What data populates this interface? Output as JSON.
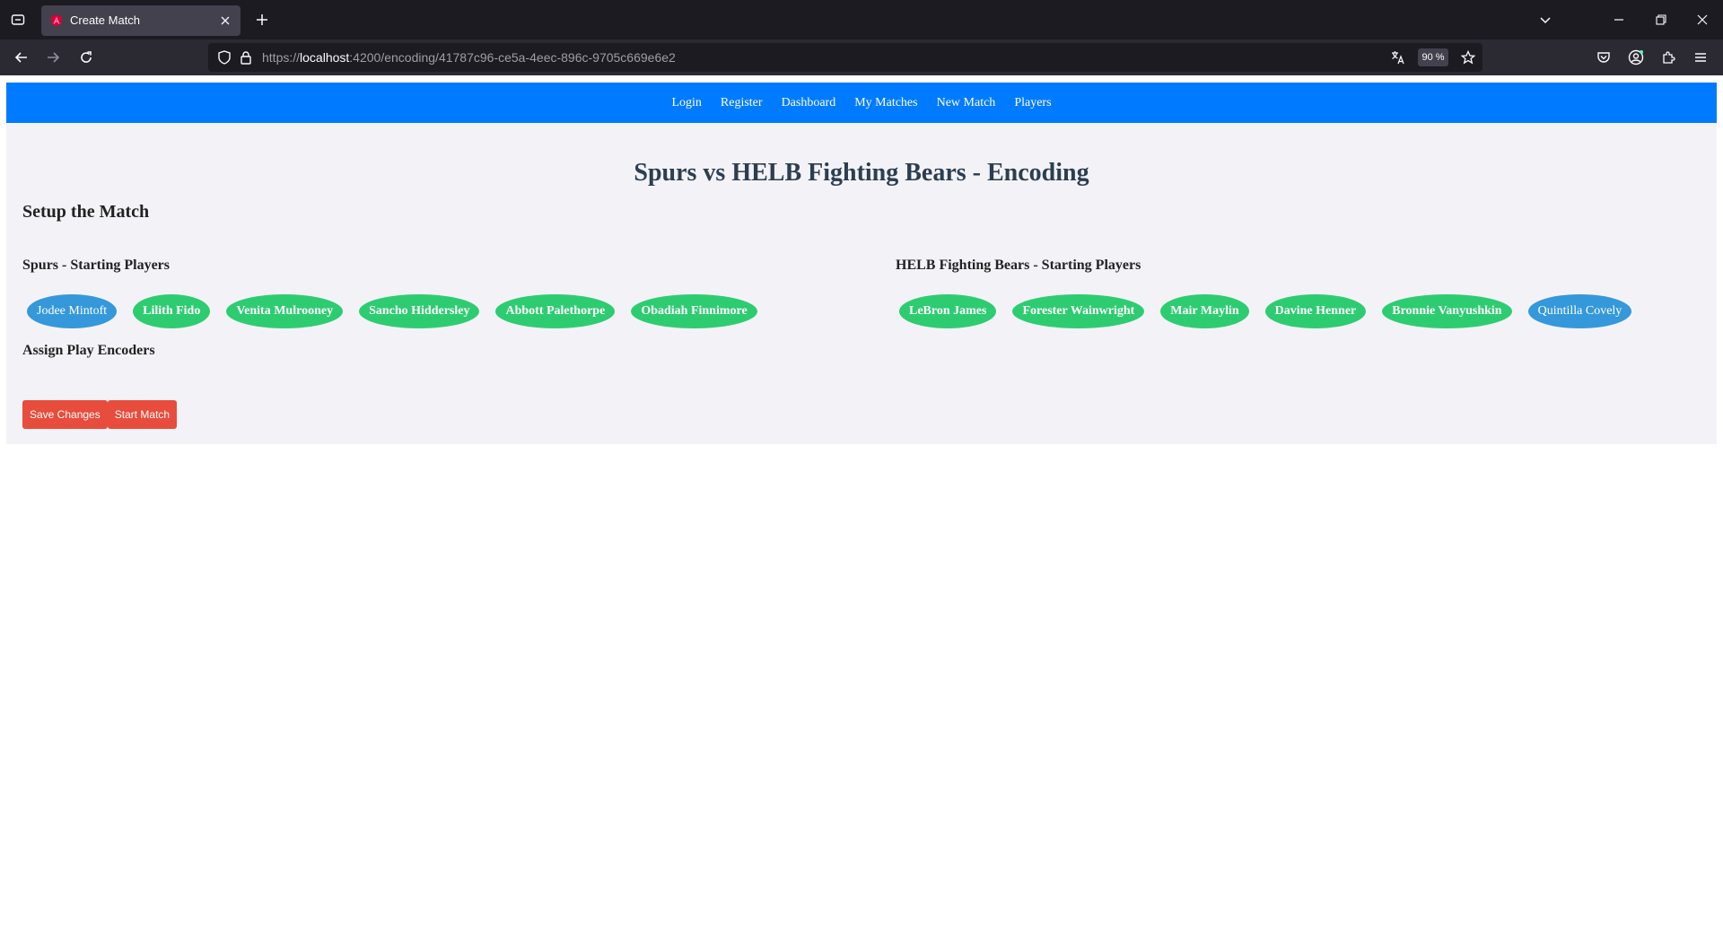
{
  "browser": {
    "tab": {
      "title": "Create Match"
    },
    "url": {
      "scheme": "https://",
      "host": "localhost",
      "rest": ":4200/encoding/41787c96-ce5a-4eec-896c-9705c669e6e2"
    },
    "zoom": "90 %"
  },
  "nav": {
    "links": [
      "Login",
      "Register",
      "Dashboard",
      "My Matches",
      "New Match",
      "Players"
    ]
  },
  "page": {
    "title": "Spurs vs HELB Fighting Bears - Encoding",
    "setup_heading": "Setup the Match",
    "assign_heading": "Assign Play Encoders"
  },
  "teams": {
    "home": {
      "heading": "Spurs - Starting Players",
      "players": [
        {
          "name": "Jodee Mintoft",
          "state": "selected"
        },
        {
          "name": "Lilith Fido",
          "state": "default"
        },
        {
          "name": "Venita Mulrooney",
          "state": "default"
        },
        {
          "name": "Sancho Hiddersley",
          "state": "default"
        },
        {
          "name": "Abbott Palethorpe",
          "state": "default"
        },
        {
          "name": "Obadiah Finnimore",
          "state": "default"
        }
      ]
    },
    "away": {
      "heading": "HELB Fighting Bears - Starting Players",
      "players": [
        {
          "name": "LeBron James",
          "state": "default"
        },
        {
          "name": "Forester Wainwright",
          "state": "default"
        },
        {
          "name": "Mair Maylin",
          "state": "default"
        },
        {
          "name": "Davine Henner",
          "state": "default"
        },
        {
          "name": "Bronnie Vanyushkin",
          "state": "default"
        },
        {
          "name": "Quintilla Covely",
          "state": "selected"
        }
      ]
    }
  },
  "actions": {
    "save": "Save Changes",
    "start": "Start Match"
  },
  "colors": {
    "nav": "#007bff",
    "player_default": "#2ecc71",
    "player_selected": "#3498db",
    "action": "#e74c3c"
  }
}
